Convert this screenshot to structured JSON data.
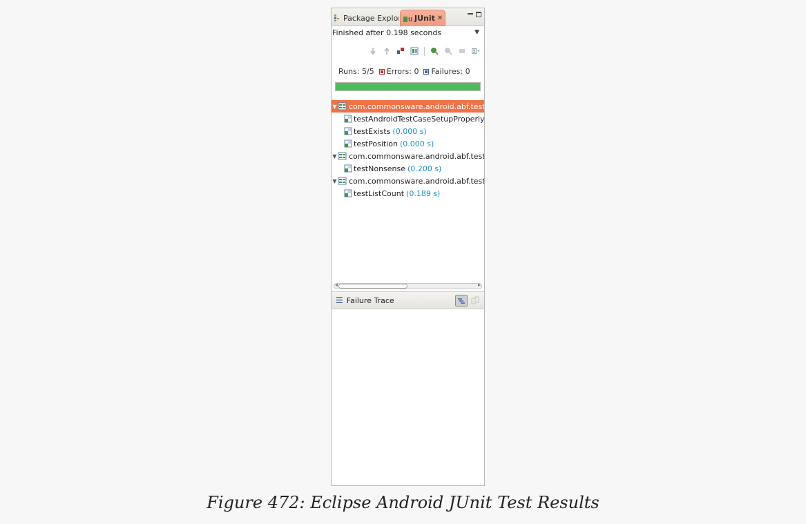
{
  "tabs": [
    {
      "label": "Package Explor",
      "icon": "package-explorer-icon",
      "active": false
    },
    {
      "label": "JUnit",
      "icon": "junit-icon",
      "active": true,
      "close": "✕"
    }
  ],
  "status": "Finished after 0.198 seconds",
  "counters": {
    "runs_label": "Runs:",
    "runs_value": "5/5",
    "errors_label": "Errors:",
    "errors_value": "0",
    "failures_label": "Failures:",
    "failures_value": "0"
  },
  "progress": {
    "fraction": 1.0,
    "color": "#4cbd5a"
  },
  "colors": {
    "selection": "#ef7347",
    "time": "#1a8fc2",
    "error": "#d02828",
    "failure": "#3a5aa6"
  },
  "tree": [
    {
      "label": "com.commonsware.android.abf.test.",
      "time": "",
      "suite": true,
      "expanded": true,
      "selected": true,
      "children": [
        {
          "label": "testAndroidTestCaseSetupProperly",
          "time": ""
        },
        {
          "label": "testExists",
          "time": "(0.000 s)"
        },
        {
          "label": "testPosition",
          "time": "(0.000 s)"
        }
      ]
    },
    {
      "label": "com.commonsware.android.abf.test.",
      "time": "",
      "suite": true,
      "expanded": true,
      "selected": false,
      "children": [
        {
          "label": "testNonsense",
          "time": "(0.200 s)"
        }
      ]
    },
    {
      "label": "com.commonsware.android.abf.test.",
      "time": "",
      "suite": true,
      "expanded": true,
      "selected": false,
      "children": [
        {
          "label": "testListCount",
          "time": "(0.189 s)"
        }
      ]
    }
  ],
  "trace": {
    "title": "Failure Trace"
  },
  "caption": "Figure 472: Eclipse Android JUnit Test Results"
}
